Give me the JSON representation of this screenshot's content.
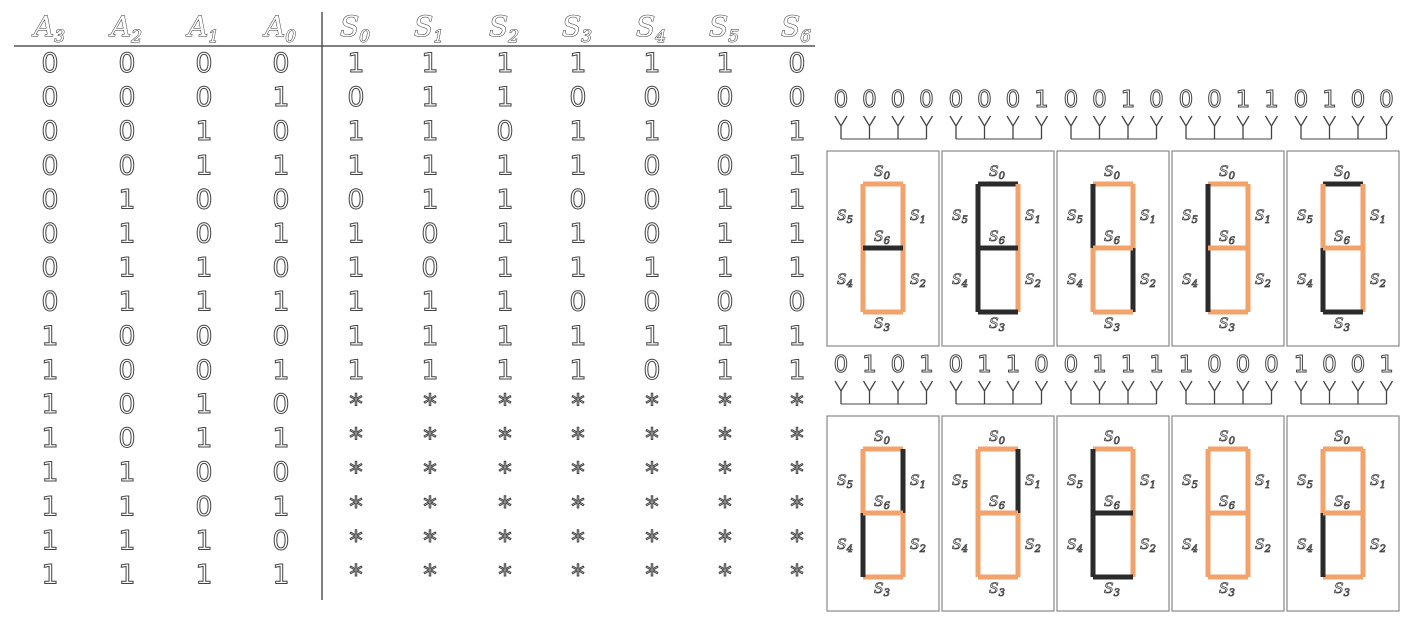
{
  "truth_table": {
    "input_headers": [
      {
        "letter": "A",
        "sub": "3"
      },
      {
        "letter": "A",
        "sub": "2"
      },
      {
        "letter": "A",
        "sub": "1"
      },
      {
        "letter": "A",
        "sub": "0"
      }
    ],
    "output_headers": [
      {
        "letter": "S",
        "sub": "0"
      },
      {
        "letter": "S",
        "sub": "1"
      },
      {
        "letter": "S",
        "sub": "2"
      },
      {
        "letter": "S",
        "sub": "3"
      },
      {
        "letter": "S",
        "sub": "4"
      },
      {
        "letter": "S",
        "sub": "5"
      },
      {
        "letter": "S",
        "sub": "6"
      }
    ],
    "rows": [
      {
        "inputs": [
          "0",
          "0",
          "0",
          "0"
        ],
        "outputs": [
          "1",
          "1",
          "1",
          "1",
          "1",
          "1",
          "0"
        ]
      },
      {
        "inputs": [
          "0",
          "0",
          "0",
          "1"
        ],
        "outputs": [
          "0",
          "1",
          "1",
          "0",
          "0",
          "0",
          "0"
        ]
      },
      {
        "inputs": [
          "0",
          "0",
          "1",
          "0"
        ],
        "outputs": [
          "1",
          "1",
          "0",
          "1",
          "1",
          "0",
          "1"
        ]
      },
      {
        "inputs": [
          "0",
          "0",
          "1",
          "1"
        ],
        "outputs": [
          "1",
          "1",
          "1",
          "1",
          "0",
          "0",
          "1"
        ]
      },
      {
        "inputs": [
          "0",
          "1",
          "0",
          "0"
        ],
        "outputs": [
          "0",
          "1",
          "1",
          "0",
          "0",
          "1",
          "1"
        ]
      },
      {
        "inputs": [
          "0",
          "1",
          "0",
          "1"
        ],
        "outputs": [
          "1",
          "0",
          "1",
          "1",
          "0",
          "1",
          "1"
        ]
      },
      {
        "inputs": [
          "0",
          "1",
          "1",
          "0"
        ],
        "outputs": [
          "1",
          "0",
          "1",
          "1",
          "1",
          "1",
          "1"
        ]
      },
      {
        "inputs": [
          "0",
          "1",
          "1",
          "1"
        ],
        "outputs": [
          "1",
          "1",
          "1",
          "0",
          "0",
          "0",
          "0"
        ]
      },
      {
        "inputs": [
          "1",
          "0",
          "0",
          "0"
        ],
        "outputs": [
          "1",
          "1",
          "1",
          "1",
          "1",
          "1",
          "1"
        ]
      },
      {
        "inputs": [
          "1",
          "0",
          "0",
          "1"
        ],
        "outputs": [
          "1",
          "1",
          "1",
          "1",
          "0",
          "1",
          "1"
        ]
      },
      {
        "inputs": [
          "1",
          "0",
          "1",
          "0"
        ],
        "outputs": [
          "*",
          "*",
          "*",
          "*",
          "*",
          "*",
          "*"
        ]
      },
      {
        "inputs": [
          "1",
          "0",
          "1",
          "1"
        ],
        "outputs": [
          "*",
          "*",
          "*",
          "*",
          "*",
          "*",
          "*"
        ]
      },
      {
        "inputs": [
          "1",
          "1",
          "0",
          "0"
        ],
        "outputs": [
          "*",
          "*",
          "*",
          "*",
          "*",
          "*",
          "*"
        ]
      },
      {
        "inputs": [
          "1",
          "1",
          "0",
          "1"
        ],
        "outputs": [
          "*",
          "*",
          "*",
          "*",
          "*",
          "*",
          "*"
        ]
      },
      {
        "inputs": [
          "1",
          "1",
          "1",
          "0"
        ],
        "outputs": [
          "*",
          "*",
          "*",
          "*",
          "*",
          "*",
          "*"
        ]
      },
      {
        "inputs": [
          "1",
          "1",
          "1",
          "1"
        ],
        "outputs": [
          "*",
          "*",
          "*",
          "*",
          "*",
          "*",
          "*"
        ]
      }
    ]
  },
  "displays": {
    "segment_labels": [
      {
        "letter": "S",
        "sub": "0"
      },
      {
        "letter": "S",
        "sub": "1"
      },
      {
        "letter": "S",
        "sub": "2"
      },
      {
        "letter": "S",
        "sub": "3"
      },
      {
        "letter": "S",
        "sub": "4"
      },
      {
        "letter": "S",
        "sub": "5"
      },
      {
        "letter": "S",
        "sub": "6"
      }
    ],
    "colors": {
      "on": "#f2a26b",
      "off": "#2b2b2b",
      "frame": "#888888"
    },
    "items": [
      {
        "inputs": [
          "0",
          "0",
          "0",
          "0"
        ],
        "digit": "0"
      },
      {
        "inputs": [
          "0",
          "0",
          "0",
          "1"
        ],
        "digit": "1"
      },
      {
        "inputs": [
          "0",
          "0",
          "1",
          "0"
        ],
        "digit": "2"
      },
      {
        "inputs": [
          "0",
          "0",
          "1",
          "1"
        ],
        "digit": "3"
      },
      {
        "inputs": [
          "0",
          "1",
          "0",
          "0"
        ],
        "digit": "4"
      },
      {
        "inputs": [
          "0",
          "1",
          "0",
          "1"
        ],
        "digit": "5"
      },
      {
        "inputs": [
          "0",
          "1",
          "1",
          "0"
        ],
        "digit": "6"
      },
      {
        "inputs": [
          "0",
          "1",
          "1",
          "1"
        ],
        "digit": "7"
      },
      {
        "inputs": [
          "1",
          "0",
          "0",
          "0"
        ],
        "digit": "8"
      },
      {
        "inputs": [
          "1",
          "0",
          "0",
          "1"
        ],
        "digit": "9"
      }
    ]
  }
}
